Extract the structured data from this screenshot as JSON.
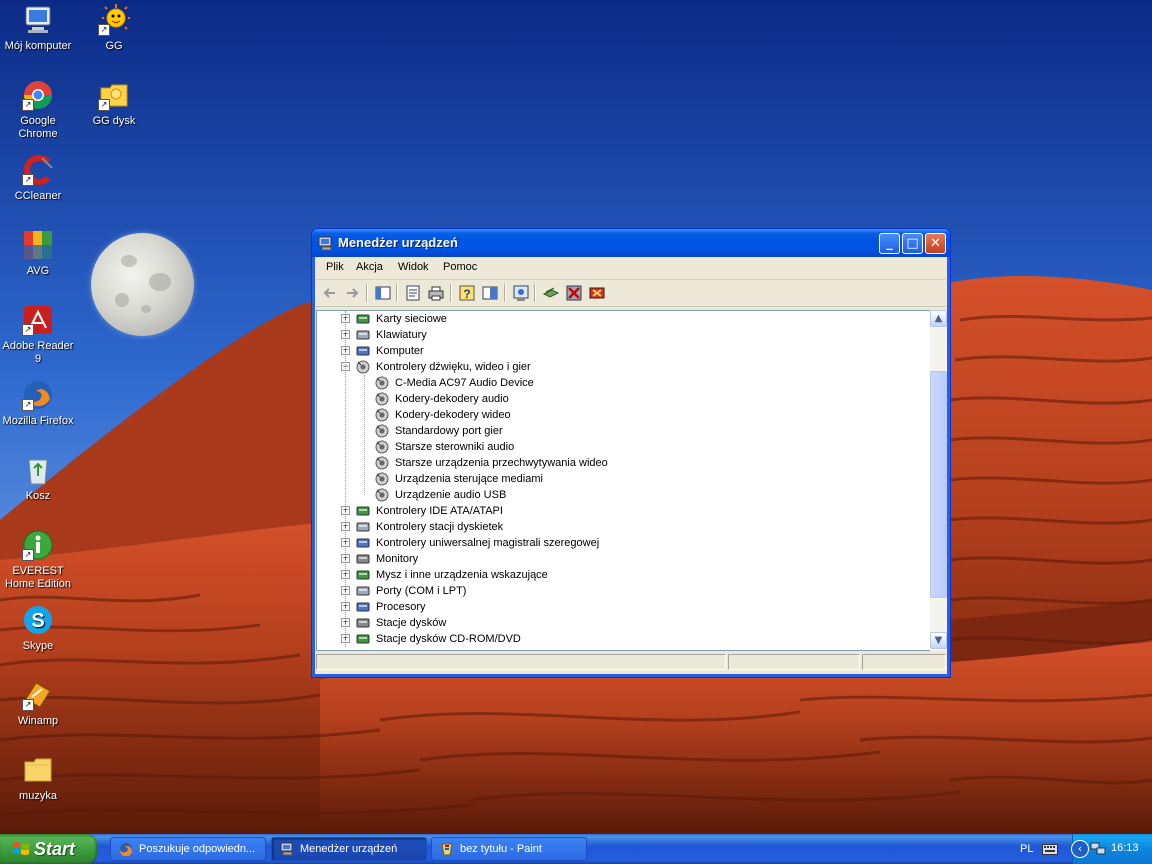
{
  "desktop": {
    "icons": [
      {
        "label": "Mój komputer",
        "icon": "my-computer-icon"
      },
      {
        "label": "GG",
        "icon": "gg-sun-icon"
      },
      {
        "label": "Google Chrome",
        "icon": "chrome-icon"
      },
      {
        "label": "GG dysk",
        "icon": "gg-disk-icon"
      },
      {
        "label": "CCleaner",
        "icon": "ccleaner-icon"
      },
      {
        "label": "AVG",
        "icon": "avg-icon"
      },
      {
        "label": "Adobe Reader 9",
        "icon": "adobe-reader-icon"
      },
      {
        "label": "Mozilla Firefox",
        "icon": "firefox-icon"
      },
      {
        "label": "Kosz",
        "icon": "recycle-bin-icon"
      },
      {
        "label": "EVEREST Home Edition",
        "icon": "everest-icon"
      },
      {
        "label": "Skype",
        "icon": "skype-icon"
      },
      {
        "label": "Winamp",
        "icon": "winamp-icon"
      },
      {
        "label": "muzyka",
        "icon": "folder-icon"
      }
    ]
  },
  "window": {
    "title": "Menedżer urządzeń",
    "menu": [
      "Plik",
      "Akcja",
      "Widok",
      "Pomoc"
    ],
    "tree": [
      {
        "label": "Karty sieciowe",
        "level": 0,
        "expander": "+"
      },
      {
        "label": "Klawiatury",
        "level": 0,
        "expander": "+"
      },
      {
        "label": "Komputer",
        "level": 0,
        "expander": "+"
      },
      {
        "label": "Kontrolery dźwięku, wideo i gier",
        "level": 0,
        "expander": "−"
      },
      {
        "label": "C-Media AC97 Audio Device",
        "level": 1
      },
      {
        "label": "Kodery-dekodery audio",
        "level": 1
      },
      {
        "label": "Kodery-dekodery wideo",
        "level": 1
      },
      {
        "label": "Standardowy port gier",
        "level": 1
      },
      {
        "label": "Starsze sterowniki audio",
        "level": 1
      },
      {
        "label": "Starsze urządzenia przechwytywania wideo",
        "level": 1
      },
      {
        "label": "Urządzenia sterujące mediami",
        "level": 1
      },
      {
        "label": "Urządzenie audio USB",
        "level": 1
      },
      {
        "label": "Kontrolery IDE ATA/ATAPI",
        "level": 0,
        "expander": "+"
      },
      {
        "label": "Kontrolery stacji dyskietek",
        "level": 0,
        "expander": "+"
      },
      {
        "label": "Kontrolery uniwersalnej magistrali szeregowej",
        "level": 0,
        "expander": "+"
      },
      {
        "label": "Monitory",
        "level": 0,
        "expander": "+"
      },
      {
        "label": "Mysz i inne urządzenia wskazujące",
        "level": 0,
        "expander": "+"
      },
      {
        "label": "Porty (COM i LPT)",
        "level": 0,
        "expander": "+"
      },
      {
        "label": "Procesory",
        "level": 0,
        "expander": "+"
      },
      {
        "label": "Stacje dysków",
        "level": 0,
        "expander": "+"
      },
      {
        "label": "Stacje dysków CD-ROM/DVD",
        "level": 0,
        "expander": "+"
      }
    ]
  },
  "taskbar": {
    "start_label": "Start",
    "tasks": [
      {
        "label": "Poszukuje odpowiedn...",
        "icon": "firefox-icon",
        "active": false
      },
      {
        "label": "Menedżer urządzeń",
        "icon": "device-manager-icon",
        "active": true
      },
      {
        "label": "bez tytułu - Paint",
        "icon": "paint-icon",
        "active": false
      }
    ],
    "language": "PL",
    "clock": "16:13"
  }
}
